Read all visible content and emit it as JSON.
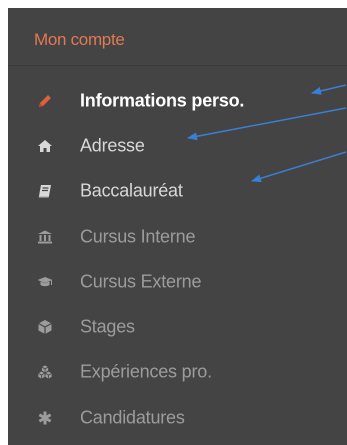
{
  "header": {
    "title": "Mon compte"
  },
  "menu": {
    "items": [
      {
        "label": "Informations perso.",
        "icon": "pencil-icon",
        "state": "active"
      },
      {
        "label": "Adresse",
        "icon": "home-icon",
        "state": "mid"
      },
      {
        "label": "Baccalauréat",
        "icon": "book-icon",
        "state": "mid"
      },
      {
        "label": "Cursus Interne",
        "icon": "bank-icon",
        "state": "dim"
      },
      {
        "label": "Cursus Externe",
        "icon": "graduation-cap-icon",
        "state": "dim"
      },
      {
        "label": "Stages",
        "icon": "cube-icon",
        "state": "dim"
      },
      {
        "label": "Expériences pro.",
        "icon": "cubes-icon",
        "state": "dim"
      },
      {
        "label": "Candidatures",
        "icon": "asterisk-icon",
        "state": "dim"
      }
    ]
  },
  "colors": {
    "panel_bg": "#444444",
    "header_text": "#e07a52",
    "active_icon": "#e0603c",
    "arrow": "#3a7fd5"
  }
}
